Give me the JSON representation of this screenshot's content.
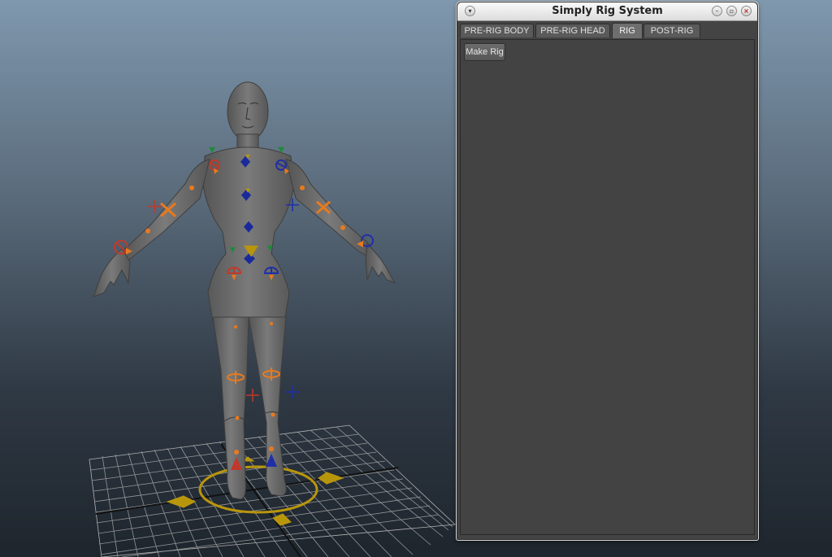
{
  "window": {
    "title": "Simply Rig System",
    "menu_icon": "chevron-down-icon",
    "controls": [
      "minimize-icon",
      "maximize-icon",
      "close-icon"
    ]
  },
  "tabs": [
    {
      "label": "PRE-RIG BODY",
      "active": false
    },
    {
      "label": "PRE-RIG HEAD",
      "active": false
    },
    {
      "label": "RIG",
      "active": true
    },
    {
      "label": "POST-RIG",
      "active": false
    }
  ],
  "panel": {
    "make_rig_label": "Make Rig"
  },
  "viewport": {
    "background_top": "#7f98ae",
    "background_bottom": "#1e252d",
    "model_color": "#6f6f6f",
    "control_colors": {
      "left": "#c0392b",
      "right": "#1f2fa8",
      "center": "#e87a1e",
      "spine": "#1a2a9a",
      "marker": "#1e8a3a",
      "root": "#b8960c"
    }
  }
}
